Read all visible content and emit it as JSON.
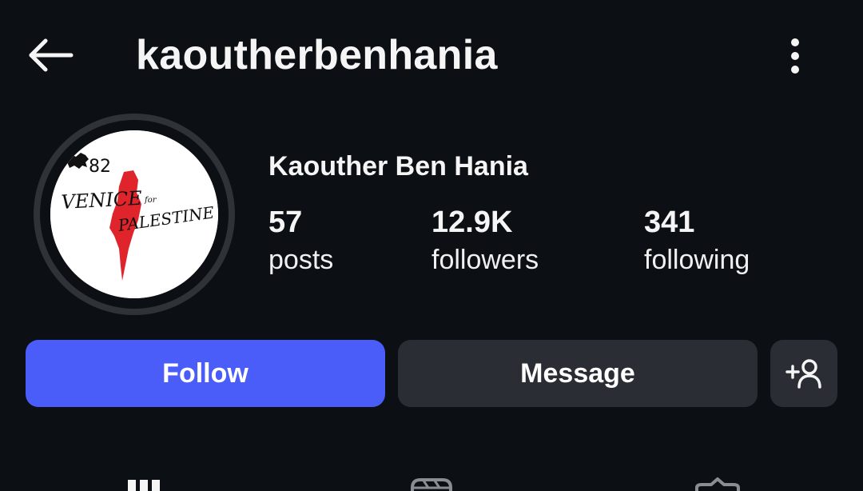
{
  "header": {
    "username": "kaoutherbenhania",
    "back_icon": "arrow-left-icon",
    "more_icon": "vertical-dots-icon"
  },
  "profile": {
    "display_name": "Kaouther Ben Hania",
    "avatar": {
      "number": "82",
      "text_line1": "VENICE",
      "text_for": "for",
      "text_line2": "PALESTINE"
    }
  },
  "stats": [
    {
      "value": "57",
      "label": "posts"
    },
    {
      "value": "12.9K",
      "label": "followers"
    },
    {
      "value": "341",
      "label": "following"
    }
  ],
  "actions": {
    "follow_label": "Follow",
    "message_label": "Message",
    "suggest_icon": "add-person-icon"
  },
  "tabs": [
    {
      "icon": "grid-icon"
    },
    {
      "icon": "reels-icon"
    },
    {
      "icon": "tagged-icon"
    }
  ],
  "colors": {
    "background": "#0c0f14",
    "follow_button": "#4a5df9",
    "secondary_button": "#2a2d33",
    "avatar_accent": "#e0242b"
  }
}
